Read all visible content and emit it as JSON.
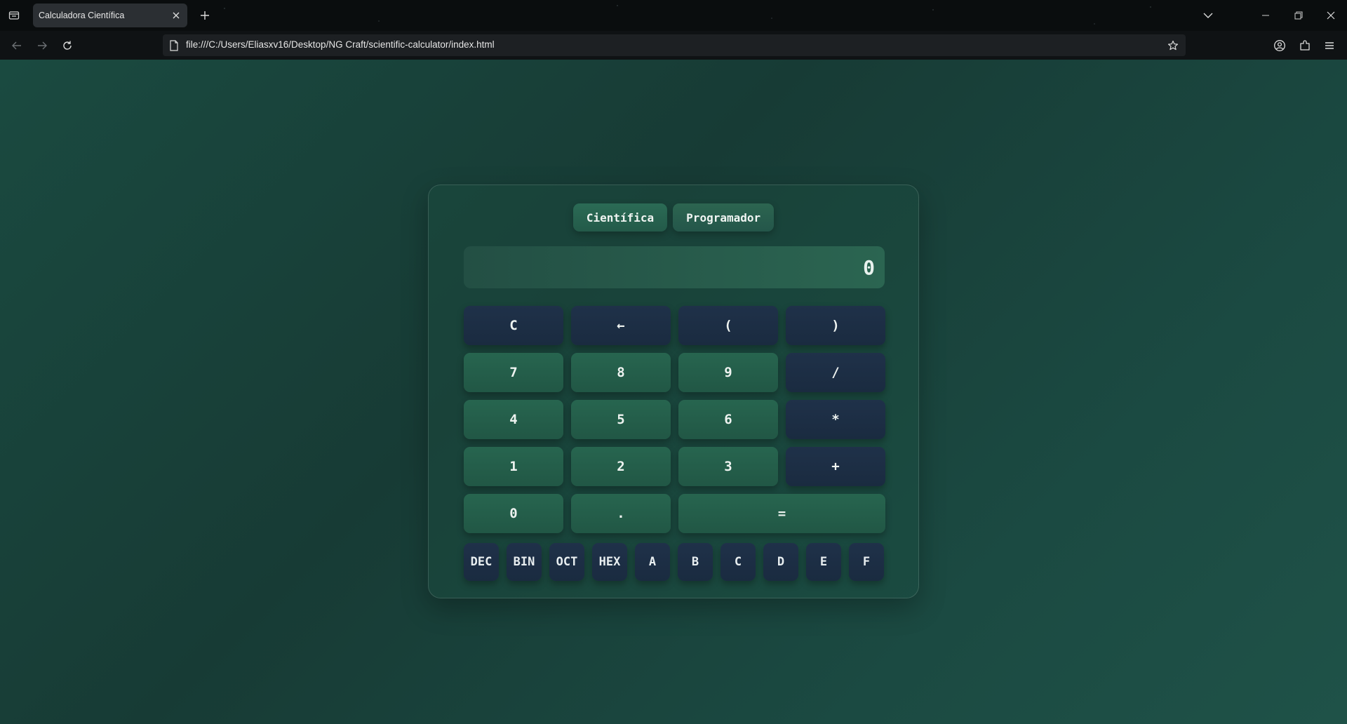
{
  "browser": {
    "tab_title": "Calculadora Científica",
    "url": "file:///C:/Users/Eliasxv16/Desktop/NG Craft/scientific-calculator/index.html",
    "icons": [
      "tab-list-icon",
      "close-icon",
      "plus-icon",
      "chevron-down-icon",
      "minimize-icon",
      "restore-icon",
      "back-icon",
      "forward-icon",
      "reload-icon",
      "page-icon",
      "star-icon",
      "account-icon",
      "extensions-icon",
      "menu-icon"
    ]
  },
  "calculator": {
    "modes": [
      "Científica",
      "Programador"
    ],
    "display_value": "0",
    "keys": [
      {
        "label": "C",
        "style": "dark"
      },
      {
        "label": "←",
        "style": "dark"
      },
      {
        "label": "(",
        "style": "dark"
      },
      {
        "label": ")",
        "style": "dark"
      },
      {
        "label": "7",
        "style": "green"
      },
      {
        "label": "8",
        "style": "green"
      },
      {
        "label": "9",
        "style": "green"
      },
      {
        "label": "/",
        "style": "dark"
      },
      {
        "label": "4",
        "style": "green"
      },
      {
        "label": "5",
        "style": "green"
      },
      {
        "label": "6",
        "style": "green"
      },
      {
        "label": "*",
        "style": "dark"
      },
      {
        "label": "1",
        "style": "green"
      },
      {
        "label": "2",
        "style": "green"
      },
      {
        "label": "3",
        "style": "green"
      },
      {
        "label": "+",
        "style": "dark"
      },
      {
        "label": "0",
        "style": "green"
      },
      {
        "label": ".",
        "style": "green"
      },
      {
        "label": "=",
        "style": "green"
      }
    ],
    "base_keys": [
      "DEC",
      "BIN",
      "OCT",
      "HEX",
      "A",
      "B",
      "C",
      "D",
      "E",
      "F"
    ]
  },
  "colors": {
    "background": "#1a4a40",
    "key_dark": "#1f3149",
    "key_green": "#27654f"
  }
}
